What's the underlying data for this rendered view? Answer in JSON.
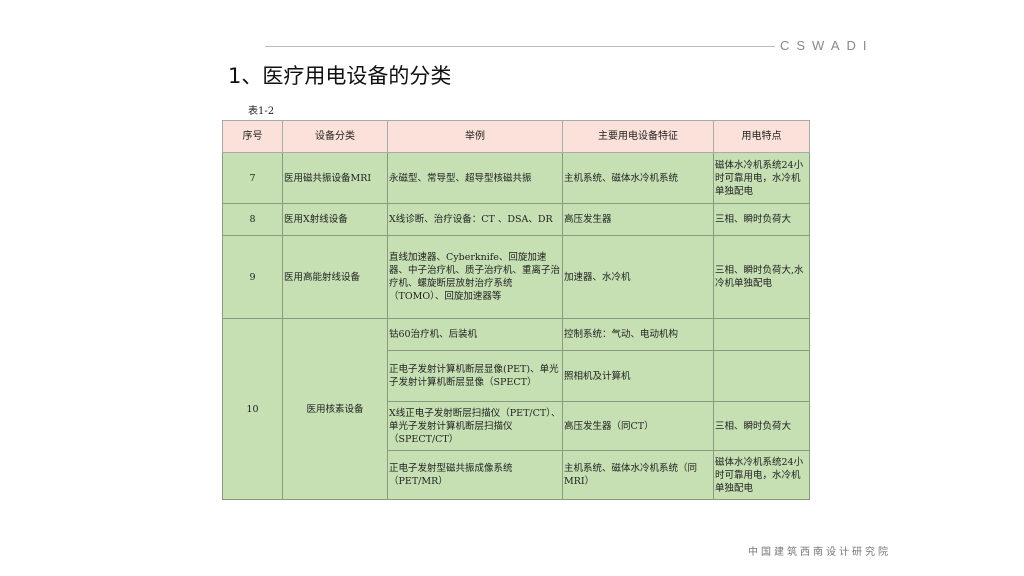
{
  "header": {
    "brand": "CSWADI",
    "title": "1、医疗用电设备的分类",
    "caption": "表1-2"
  },
  "table": {
    "columns": [
      "序号",
      "设备分类",
      "举例",
      "主要用电设备特征",
      "用电特点"
    ],
    "rows": [
      {
        "no": "7",
        "category": "医用磁共振设备MRI",
        "example": "永磁型、常导型、超导型核磁共振",
        "feature": "主机系统、磁体水冷机系统",
        "power": "磁体水冷机系统24小时可靠用电，水冷机单独配电"
      },
      {
        "no": "8",
        "category": "医用X射线设备",
        "example": "X线诊断、治疗设备：CT 、DSA、DR",
        "feature": "高压发生器",
        "power": "三相、瞬时负荷大"
      },
      {
        "no": "9",
        "category": "医用高能射线设备",
        "example": "直线加速器、Cyberknife、回旋加速器、中子治疗机、质子治疗机、重离子治疗机、螺旋断层放射治疗系统（TOMO）、回旋加速器等",
        "feature": "加速器、水冷机",
        "power": "三相、瞬时负荷大,水冷机单独配电"
      }
    ],
    "group": {
      "no": "10",
      "category": "医用核素设备",
      "subrows": [
        {
          "example": "钴60治疗机、后装机",
          "feature": "控制系统：气动、电动机构",
          "power": ""
        },
        {
          "example": "正电子发射计算机断层显像(PET)、单光子发射计算机断层显像（SPECT）",
          "feature": "照相机及计算机",
          "power": ""
        },
        {
          "example": "X线正电子发射断层扫描仪（PET/CT）、单光子发射计算机断层扫描仪（SPECT/CT）",
          "feature": "高压发生器（同CT）",
          "power": "三相、瞬时负荷大"
        },
        {
          "example": "正电子发射型磁共振成像系统（PET/MR）",
          "feature": "主机系统、磁体水冷机系统（同MRI）",
          "power": "磁体水冷机系统24小时可靠用电，水冷机单独配电"
        }
      ]
    }
  },
  "footer": "中国建筑西南设计研究院"
}
